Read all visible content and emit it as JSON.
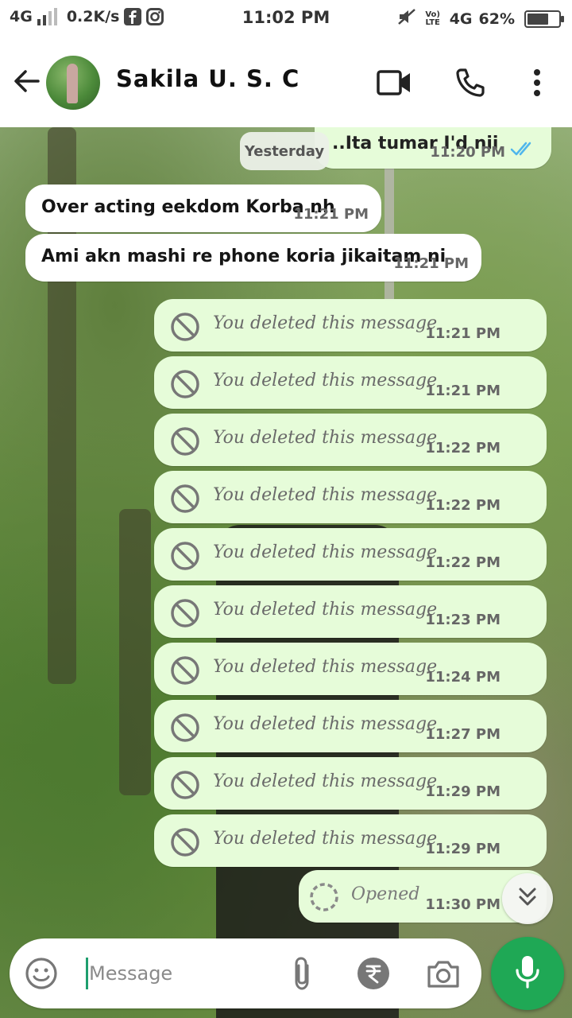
{
  "status_bar": {
    "network": "4G",
    "speed": "0.2K/s",
    "time": "11:02 PM",
    "volte": "Vo) LTE",
    "network_right": "4G",
    "battery": "62%",
    "battery_level": 0.62
  },
  "header": {
    "contact_name": "Sakila U. S. C",
    "icons": [
      "back-arrow-icon",
      "avatar",
      "video-call-icon",
      "phone-icon",
      "more-vert-icon"
    ]
  },
  "chat": {
    "date_chip": "Yesterday",
    "partial_out": {
      "text": "..Ita tumar I'd nii",
      "time": "11:20 PM"
    },
    "incoming": [
      {
        "text": "Over acting eekdom Korba nh",
        "time": "11:21 PM"
      },
      {
        "text": "Ami akn mashi re phone koria jikaitam ni",
        "time": "11:21 PM"
      }
    ],
    "deleted_label": "You deleted this message",
    "deleted": [
      {
        "time": "11:21 PM"
      },
      {
        "time": "11:21 PM"
      },
      {
        "time": "11:22 PM"
      },
      {
        "time": "11:22 PM"
      },
      {
        "time": "11:22 PM"
      },
      {
        "time": "11:23 PM"
      },
      {
        "time": "11:24 PM"
      },
      {
        "time": "11:27 PM"
      },
      {
        "time": "11:29 PM"
      },
      {
        "time": "11:29 PM"
      }
    ],
    "opened": {
      "text": "Opened",
      "time": "11:30 PM"
    },
    "colors": {
      "outgoing": "#e6fcd9",
      "incoming": "#ffffff",
      "read_ticks": "#4fb6ec",
      "accent": "#1fa855"
    }
  },
  "composer": {
    "placeholder": "Message",
    "icons": [
      "emoji-icon",
      "attach-icon",
      "rupee-payment-icon",
      "camera-icon",
      "mic-icon"
    ]
  }
}
